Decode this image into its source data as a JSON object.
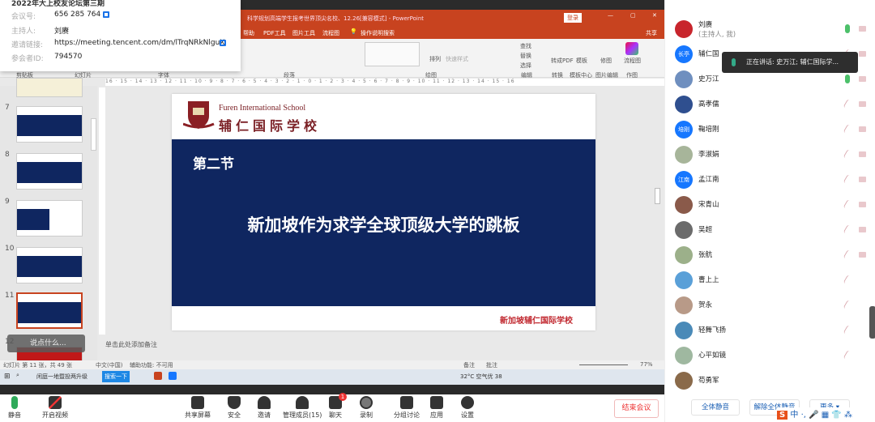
{
  "meeting_info": {
    "title": "2022年大上校友论坛第三期",
    "rows": [
      {
        "key": "会议号:",
        "value": "656 285 764"
      },
      {
        "key": "主持人:",
        "value": "刘赓"
      },
      {
        "key": "邀请链接:",
        "value": "https://meeting.tencent.com/dm/lTrqNRkNlguX"
      },
      {
        "key": "参会者ID:",
        "value": "794570"
      }
    ]
  },
  "ppt": {
    "title": "科学规划高端学生报考世界顶尖名校、12.26[兼容模式] - PowerPoint",
    "login": "登录",
    "share": "共享",
    "tabs": [
      "帮助",
      "PDF工具",
      "图片工具",
      "流程图",
      "操作说明搜索"
    ],
    "ribbon_groups": [
      "剪贴板",
      "幻灯片",
      "字体",
      "段落",
      "绘图",
      "编辑",
      "转换",
      "模板中心",
      "图片编辑",
      "作图"
    ],
    "ribbon_items": [
      "查找",
      "替换",
      "选择",
      "转成PDF",
      "模板",
      "修图",
      "流程图",
      "排列",
      "快速样式"
    ],
    "ruler": "16 · 15 · 14 · 13 · 12 · 11 · 10 · 9 · 8 · 7 · 6 · 5 · 4 · 3 · 2 · 1 · 0 · 1 · 2 · 3 · 4 · 5 · 6 · 7 · 8 · 9 · 10 · 11 · 12 · 13 · 14 · 15 · 16",
    "thumb_numbers": [
      "7",
      "8",
      "9",
      "10",
      "11",
      "12"
    ],
    "speak_bubble": "说点什么...",
    "notes_placeholder": "单击此处添加备注",
    "status_left": "幻灯片 第 11 张，共 49 张",
    "status_lang": "中文(中国)",
    "status_access": "辅助功能: 不可用",
    "status_notes": "备注",
    "status_comments": "批注",
    "zoom": "77%"
  },
  "slide": {
    "school_en": "Furen International School",
    "school_cn": "辅仁国际学校",
    "section": "第二节",
    "headline": "新加坡作为求学全球顶级大学的跳板",
    "footer": "新加坡辅仁国际学校",
    "accent": "#0f2660",
    "footer_color": "#c0262d"
  },
  "taskbar": {
    "browser_tab": "闲庭一地暨投两升级",
    "search_btn": "搜索一下",
    "weather": "32°C 空气优 38"
  },
  "toolbar": {
    "mute": "静音",
    "video": "开启视频",
    "share": "共享屏幕",
    "security": "安全",
    "invite": "邀请",
    "manage": "管理成员(15)",
    "chat": "聊天",
    "chat_badge": "1",
    "record": "录制",
    "breakout": "分组讨论",
    "apps": "应用",
    "settings": "设置",
    "end": "结束会议"
  },
  "participants": {
    "speaking_tooltip": "正在讲话: 史万江; 辅仁国际学...",
    "list": [
      {
        "name": "刘赓",
        "sub": "(主持人, 我)",
        "mic": "on",
        "avatar": "#c8252c"
      },
      {
        "name": "辅仁国",
        "mic": "off",
        "avatar": "#1677ff",
        "avatar_text": "长亭"
      },
      {
        "name": "史万江",
        "mic": "on",
        "avatar": "#6f8fbf"
      },
      {
        "name": "高孝儒",
        "mic": "off",
        "avatar": "#2f4f8f"
      },
      {
        "name": "鞠培刚",
        "mic": "off",
        "avatar": "#1677ff",
        "avatar_text": "培刚"
      },
      {
        "name": "李淑娟",
        "mic": "off",
        "avatar": "#a7b59a"
      },
      {
        "name": "孟江南",
        "mic": "off",
        "avatar": "#1677ff",
        "avatar_text": "江南"
      },
      {
        "name": "宋青山",
        "mic": "off",
        "avatar": "#8a5a4a"
      },
      {
        "name": "吴超",
        "mic": "off",
        "avatar": "#6b6b6b"
      },
      {
        "name": "张航",
        "mic": "off",
        "avatar": "#9cb08a"
      },
      {
        "name": "曹上上",
        "mic": "off",
        "avatar": "#5aa0d8"
      },
      {
        "name": "贺永",
        "mic": "off",
        "avatar": "#b89a88"
      },
      {
        "name": "轻舞飞扬",
        "mic": "off",
        "avatar": "#4a8ab8"
      },
      {
        "name": "心平如镜",
        "mic": "off",
        "avatar": "#9fb8a0"
      },
      {
        "name": "苟勇军",
        "mic": "none",
        "avatar": "#8a6a4a"
      }
    ],
    "mute_all": "全体静音",
    "unmute_all": "解除全体静音",
    "more": "更多 ▾"
  },
  "ime": {
    "lang": "中"
  }
}
